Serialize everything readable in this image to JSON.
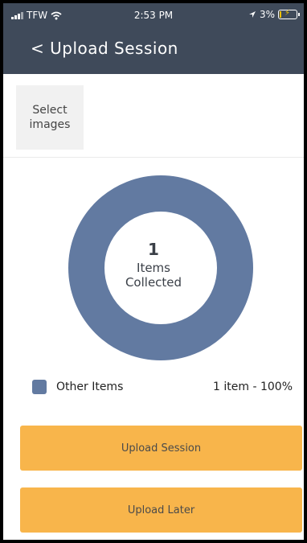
{
  "status_bar": {
    "carrier": "TFW",
    "time": "2:53 PM",
    "battery_percent": "3%",
    "icons": [
      "signal-icon",
      "wifi-icon",
      "location-arrow-icon",
      "battery-charging-icon"
    ]
  },
  "nav": {
    "title": "< Upload Session"
  },
  "select_images": {
    "label": "Select images"
  },
  "donut": {
    "count": "1",
    "label": "Items Collected"
  },
  "chart_data": {
    "type": "pie",
    "series": [
      {
        "name": "Other Items",
        "values": [
          1
        ]
      }
    ],
    "categories": [
      "Other Items"
    ],
    "percent": [
      100
    ]
  },
  "legend": {
    "items": [
      {
        "name": "Other Items",
        "value": "1 item - 100%"
      }
    ]
  },
  "buttons": {
    "upload_session": "Upload Session",
    "upload_later": "Upload Later"
  },
  "colors": {
    "header_bg": "#3f4a5a",
    "donut": "#627aa1",
    "button": "#f8b54b"
  }
}
